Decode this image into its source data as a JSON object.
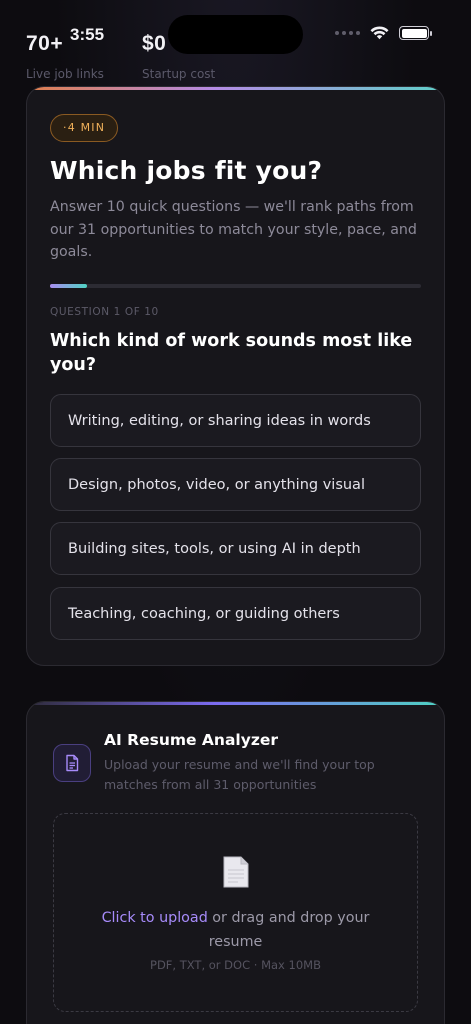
{
  "status_bar": {
    "time": "3:55"
  },
  "stats": [
    {
      "value": "70+",
      "label": "Live job links"
    },
    {
      "value": "$0",
      "label": "Startup cost"
    }
  ],
  "quiz": {
    "badge": "·4 MIN",
    "title": "Which jobs fit you?",
    "subtitle": "Answer 10 quick questions — we'll rank paths from our 31 opportunities to match your style, pace, and goals.",
    "progress": 0.1,
    "counter": "QUESTION 1 OF 10",
    "question": "Which kind of work sounds most like you?",
    "options": [
      "Writing, editing, or sharing ideas in words",
      "Design, photos, video, or anything visual",
      "Building sites, tools, or using AI in depth",
      "Teaching, coaching, or guiding others"
    ]
  },
  "resume": {
    "title": "AI Resume Analyzer",
    "subtitle": "Upload your resume and we'll find your top matches from all 31 opportunities",
    "upload_link": "Click to upload",
    "upload_rest": " or drag and drop your resume",
    "hint": "PDF, TXT, or DOC · Max 10MB"
  },
  "colors": {
    "accent_purple": "#a78bfa",
    "badge_amber": "#f0b15a",
    "teal": "#4fd2c3"
  }
}
